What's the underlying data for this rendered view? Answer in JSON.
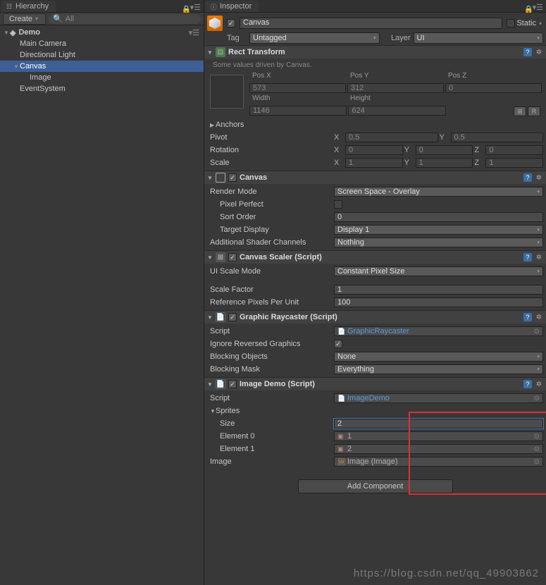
{
  "hierarchy": {
    "tab": "Hierarchy",
    "create": "Create",
    "search_placeholder": "All",
    "scene": "Demo",
    "items": [
      {
        "name": "Main Camera",
        "depth": 1
      },
      {
        "name": "Directional Light",
        "depth": 1
      },
      {
        "name": "Canvas",
        "depth": 1,
        "selected": true,
        "fold": true
      },
      {
        "name": "Image",
        "depth": 2
      },
      {
        "name": "EventSystem",
        "depth": 1
      }
    ]
  },
  "inspector": {
    "tab": "Inspector",
    "name": "Canvas",
    "static_label": "Static",
    "tag_label": "Tag",
    "tag_value": "Untagged",
    "layer_label": "Layer",
    "layer_value": "UI"
  },
  "rect": {
    "title": "Rect Transform",
    "hint": "Some values driven by Canvas.",
    "pos_x_l": "Pos X",
    "pos_y_l": "Pos Y",
    "pos_z_l": "Pos Z",
    "pos_x": "573",
    "pos_y": "312",
    "pos_z": "0",
    "width_l": "Width",
    "height_l": "Height",
    "width": "1146",
    "height": "624",
    "anchors_l": "Anchors",
    "pivot_l": "Pivot",
    "pivot_x": "0.5",
    "pivot_y": "0.5",
    "rotation_l": "Rotation",
    "rot_x": "0",
    "rot_y": "0",
    "rot_z": "0",
    "scale_l": "Scale",
    "scl_x": "1",
    "scl_y": "1",
    "scl_z": "1",
    "btn_r": "R"
  },
  "canvas": {
    "title": "Canvas",
    "render_mode_l": "Render Mode",
    "render_mode": "Screen Space - Overlay",
    "pixel_perfect_l": "Pixel Perfect",
    "sort_order_l": "Sort Order",
    "sort_order": "0",
    "target_display_l": "Target Display",
    "target_display": "Display 1",
    "shader_l": "Additional Shader Channels",
    "shader": "Nothing"
  },
  "scaler": {
    "title": "Canvas Scaler (Script)",
    "mode_l": "UI Scale Mode",
    "mode": "Constant Pixel Size",
    "factor_l": "Scale Factor",
    "factor": "1",
    "rppu_l": "Reference Pixels Per Unit",
    "rppu": "100"
  },
  "raycaster": {
    "title": "Graphic Raycaster (Script)",
    "script_l": "Script",
    "script": "GraphicRaycaster",
    "ignore_l": "Ignore Reversed Graphics",
    "blocking_obj_l": "Blocking Objects",
    "blocking_obj": "None",
    "blocking_mask_l": "Blocking Mask",
    "blocking_mask": "Everything"
  },
  "imagedemo": {
    "title": "Image Demo (Script)",
    "script_l": "Script",
    "script": "ImageDemo",
    "sprites_l": "Sprites",
    "size_l": "Size",
    "size": "2",
    "el0_l": "Element 0",
    "el0": "1",
    "el1_l": "Element 1",
    "el1": "2",
    "image_l": "Image",
    "image": "Image (Image)"
  },
  "add_component": "Add Component",
  "axis": {
    "x": "X",
    "y": "Y",
    "z": "Z"
  },
  "watermark": "https://blog.csdn.net/qq_49903862"
}
